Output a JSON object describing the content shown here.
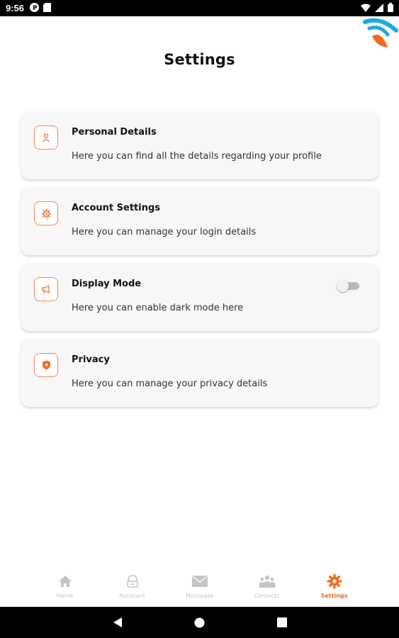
{
  "status_bar": {
    "time": "9:56",
    "left_icons": [
      "pocket-casts-icon",
      "sd-card-icon"
    ],
    "right_icons": [
      "wifi-icon",
      "signal-icon",
      "battery-icon"
    ]
  },
  "page": {
    "title": "Settings"
  },
  "settings_items": [
    {
      "title": "Personal Details",
      "description": "Here you can find all the details regarding your profile",
      "icon": "user-icon"
    },
    {
      "title": "Account Settings",
      "description": "Here you can manage your login details",
      "icon": "gear-icon"
    },
    {
      "title": "Display Mode",
      "description": "Here you can enable dark mode here",
      "icon": "megaphone-icon",
      "toggle": false
    },
    {
      "title": "Privacy",
      "description": "Here you can manage your privacy details",
      "icon": "shield-icon"
    }
  ],
  "bottom_nav": {
    "items": [
      {
        "label": "Home",
        "icon": "home-icon"
      },
      {
        "label": "Assistant",
        "icon": "assistant-icon"
      },
      {
        "label": "Messages",
        "icon": "mail-icon"
      },
      {
        "label": "Contacts",
        "icon": "contacts-icon"
      },
      {
        "label": "Settings",
        "icon": "gear-icon",
        "active": true
      }
    ]
  },
  "system_nav": [
    "back-icon",
    "home-circle-icon",
    "recents-icon"
  ],
  "colors": {
    "accent": "#f26b1d",
    "icon_border": "#f08a5a",
    "card_bg": "#f7f7f7",
    "inactive_nav": "#c4c4c4",
    "logo_blue": "#1fa8e0"
  }
}
